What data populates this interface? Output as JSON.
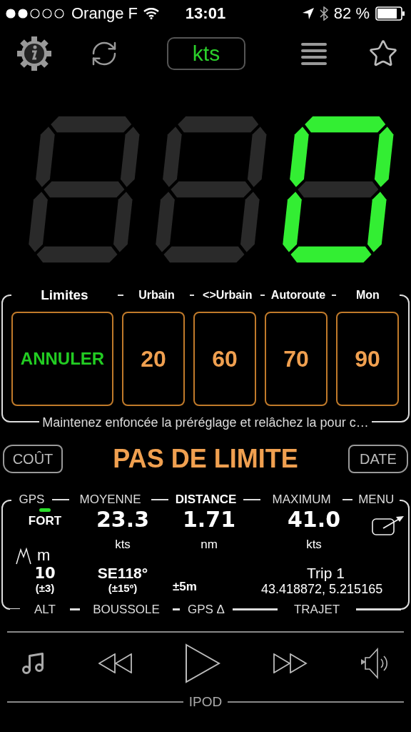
{
  "status_bar": {
    "carrier": "Orange F",
    "time": "13:01",
    "battery": "82 %"
  },
  "toolbar": {
    "unit": "kts"
  },
  "speed_display": {
    "digits": [
      {
        "segments": [
          false,
          false,
          false,
          false,
          false,
          false,
          false
        ]
      },
      {
        "segments": [
          false,
          false,
          false,
          false,
          false,
          false,
          false
        ]
      },
      {
        "segments": [
          true,
          true,
          true,
          true,
          true,
          true,
          false
        ]
      }
    ]
  },
  "limits": {
    "title": "Limites",
    "cancel": "ANNULER",
    "presets": [
      {
        "label": "Urbain",
        "value": "20"
      },
      {
        "label": "<>Urbain",
        "value": "60"
      },
      {
        "label": "Autoroute",
        "value": "70"
      },
      {
        "label": "Mon",
        "value": "90"
      }
    ],
    "hint": "Maintenez enfoncée la préréglage et relâchez la pour c…"
  },
  "limit_bar": {
    "left": "COÛT",
    "status": "PAS DE LIMITE",
    "right": "DATE"
  },
  "stats": {
    "headers": [
      {
        "label": "GPS",
        "selected": false
      },
      {
        "label": "MOYENNE",
        "selected": false
      },
      {
        "label": "DISTANCE",
        "selected": true
      },
      {
        "label": "MAXIMUM",
        "selected": false
      },
      {
        "label": "MENU",
        "selected": false
      }
    ],
    "gps_signal": "FORT",
    "average": "23.3",
    "average_unit": "kts",
    "distance": "1.71",
    "distance_unit": "nm",
    "maximum": "41.0",
    "maximum_unit": "kts",
    "altitude_unit": "m",
    "altitude": "10",
    "altitude_error": "(±3)",
    "compass": "SE118°",
    "compass_error": "(±15º)",
    "gps_error": "±5m",
    "trip_name": "Trip 1",
    "coordinates": "43.418872, 5.215165",
    "footers": [
      "ALT",
      "BOUSSOLE",
      "GPS Δ",
      "TRAJET"
    ]
  },
  "player": {
    "label": "IPOD"
  }
}
